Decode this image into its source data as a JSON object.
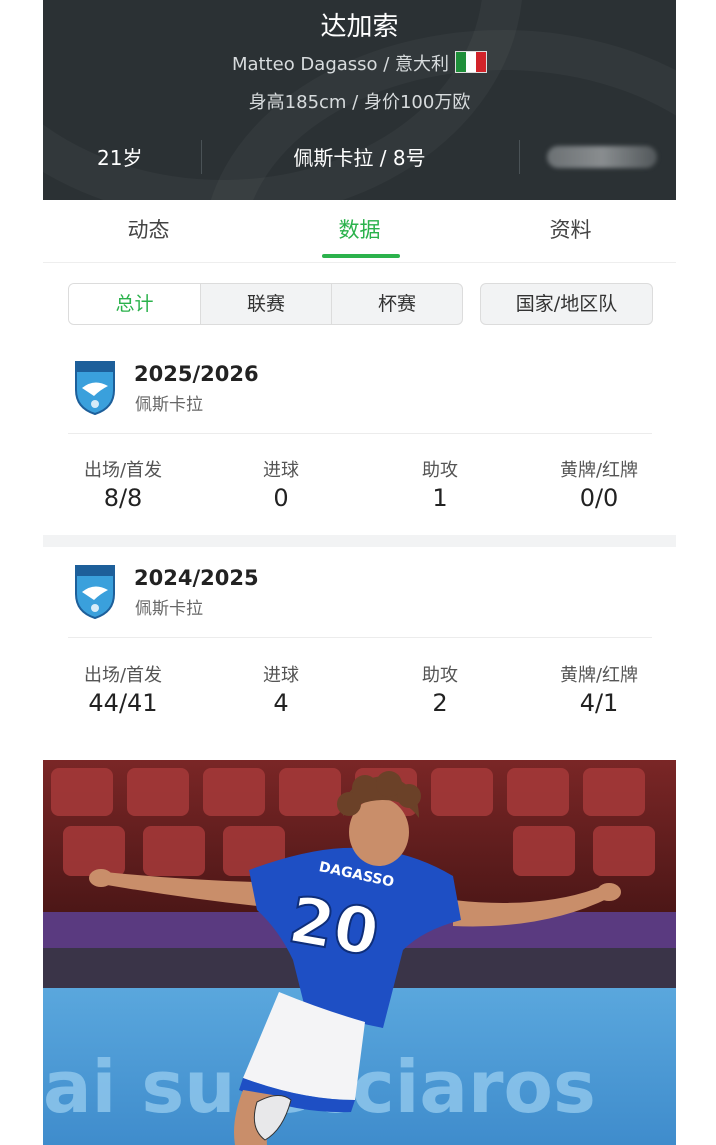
{
  "header": {
    "name": "达加索",
    "subtitle": "Matteo Dagasso / 意大利",
    "info": "身高185cm / 身价100万欧",
    "age": "21岁",
    "club_number": "佩斯卡拉 / 8号",
    "flag_colors": [
      "#1f8f3a",
      "#ffffff",
      "#d2232a"
    ],
    "background_color": "#2b3134"
  },
  "tabs": [
    {
      "label": "动态",
      "active": false
    },
    {
      "label": "数据",
      "active": true
    },
    {
      "label": "资料",
      "active": false
    }
  ],
  "filters": {
    "items": [
      {
        "label": "总计",
        "active": true
      },
      {
        "label": "联赛",
        "active": false
      },
      {
        "label": "杯赛",
        "active": false
      }
    ],
    "national": "国家/地区队"
  },
  "seasons": [
    {
      "year": "2025/2026",
      "club": "佩斯卡拉",
      "crest_icon": "pescara-crest-icon",
      "stats": [
        {
          "label": "出场/首发",
          "value": "8/8"
        },
        {
          "label": "进球",
          "value": "0"
        },
        {
          "label": "助攻",
          "value": "1"
        },
        {
          "label": "黄牌/红牌",
          "value": "0/0"
        }
      ]
    },
    {
      "year": "2024/2025",
      "club": "佩斯卡拉",
      "crest_icon": "pescara-crest-icon",
      "stats": [
        {
          "label": "出场/首发",
          "value": "44/41"
        },
        {
          "label": "进球",
          "value": "4"
        },
        {
          "label": "助攻",
          "value": "2"
        },
        {
          "label": "黄牌/红牌",
          "value": "4/1"
        }
      ]
    }
  ],
  "photo": {
    "jersey_name": "DAGASSO",
    "jersey_number": "20",
    "board_text": "ai su ecciaros"
  },
  "colors": {
    "accent": "#2bb24c",
    "jersey": "#1e4fc4"
  }
}
